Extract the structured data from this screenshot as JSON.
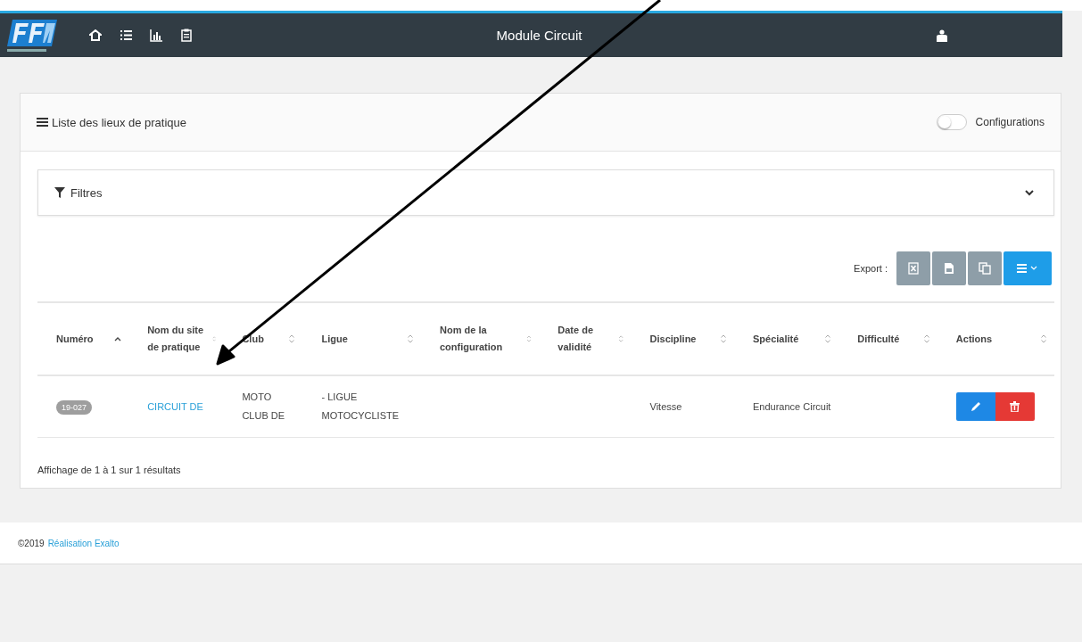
{
  "header": {
    "title": "Module Circuit"
  },
  "card": {
    "title": "Liste des lieux de pratique",
    "toggle": {
      "label": "Configurations",
      "on": false
    }
  },
  "filters": {
    "label": "Filtres",
    "expanded": false
  },
  "export": {
    "label": "Export :"
  },
  "table": {
    "columns": [
      {
        "label": "Numéro",
        "sorted_ascending": true
      },
      {
        "label": "Nom du site de pratique",
        "sorted_ascending": false
      },
      {
        "label": "Club",
        "sorted_ascending": false
      },
      {
        "label": "Ligue",
        "sorted_ascending": false
      },
      {
        "label": "Nom de la configuration",
        "sorted_ascending": false
      },
      {
        "label": "Date de validité",
        "sorted_ascending": false
      },
      {
        "label": "Discipline",
        "sorted_ascending": false
      },
      {
        "label": "Spécialité",
        "sorted_ascending": false
      },
      {
        "label": "Difficulté",
        "sorted_ascending": false
      },
      {
        "label": "Actions",
        "sorted_ascending": false
      }
    ],
    "rows": [
      {
        "numero": "19-027",
        "site": "CIRCUIT DE",
        "club": "MOTO CLUB DE",
        "ligue": "- LIGUE MOTOCYCLISTE",
        "discipline": "Vitesse",
        "specialite": "Endurance Circuit"
      }
    ]
  },
  "summary": "Affichage de 1 à 1 sur 1 résultats",
  "footer": {
    "copyright": "©2019",
    "link": "Réalisation Exalto"
  }
}
